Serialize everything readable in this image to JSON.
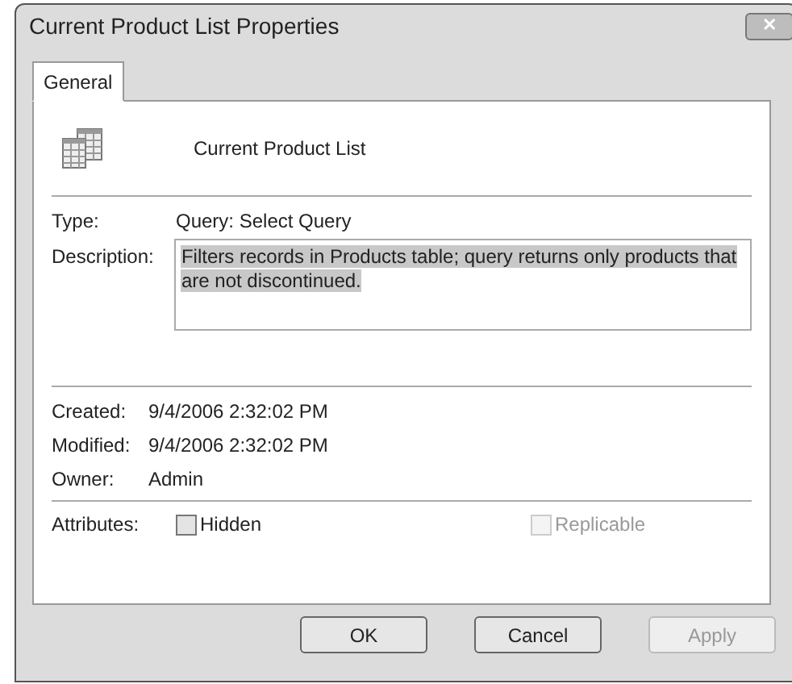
{
  "window": {
    "title": "Current Product List Properties",
    "close": "✕"
  },
  "tabs": [
    {
      "label": "General",
      "selected": true
    }
  ],
  "object_name": "Current Product List",
  "type": {
    "label": "Type:",
    "value": "Query: Select Query"
  },
  "description": {
    "label": "Description:",
    "value": "Filters records in Products table; query returns only products that are not discontinued.",
    "highlighted": true
  },
  "info": [
    {
      "label": "Created:",
      "value": "9/4/2006 2:32:02 PM"
    },
    {
      "label": "Modified:",
      "value": "9/4/2006 2:32:02 PM"
    },
    {
      "label": "Owner:",
      "value": "Admin"
    }
  ],
  "attributes": {
    "label": "Attributes:",
    "options": [
      {
        "label": "Hidden",
        "checked": false,
        "disabled": false
      },
      {
        "label": "Replicable",
        "checked": false,
        "disabled": true
      }
    ]
  },
  "buttons": [
    {
      "label": "OK",
      "disabled": false
    },
    {
      "label": "Cancel",
      "disabled": false
    },
    {
      "label": "Apply",
      "disabled": true
    }
  ]
}
